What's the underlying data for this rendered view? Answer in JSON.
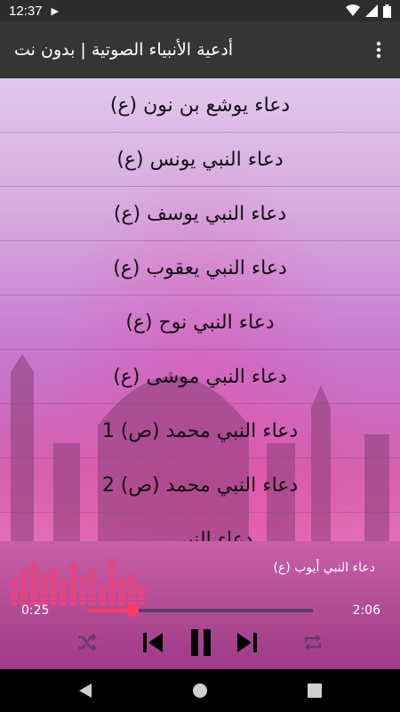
{
  "status_bar": {
    "time": "12:37"
  },
  "app_bar": {
    "title": "أدعية الأنبياء الصوتية | بدون نت"
  },
  "list": [
    {
      "label": "دعاء يوشع بن نون (ع)"
    },
    {
      "label": "دعاء النبي يونس (ع)"
    },
    {
      "label": "دعاء النبي يوسف (ع)"
    },
    {
      "label": "دعاء النبي يعقوب (ع)"
    },
    {
      "label": "دعاء النبي نوح (ع)"
    },
    {
      "label": "دعاء النبي موسى (ع)"
    },
    {
      "label": "دعاء النبي محمد (ص) 1"
    },
    {
      "label": "دعاء النبي محمد (ص) 2"
    },
    {
      "label": "دعاء النبي ..."
    }
  ],
  "player": {
    "track_title": "دعاء النبي أيوب (ع)",
    "current_time": "0:25",
    "duration": "2:06",
    "progress": 0.2
  },
  "colors": {
    "accent": "#ff3b60",
    "app_bar": "#353535",
    "status_bar": "#2d2d2d",
    "eq": "#f0407a"
  }
}
